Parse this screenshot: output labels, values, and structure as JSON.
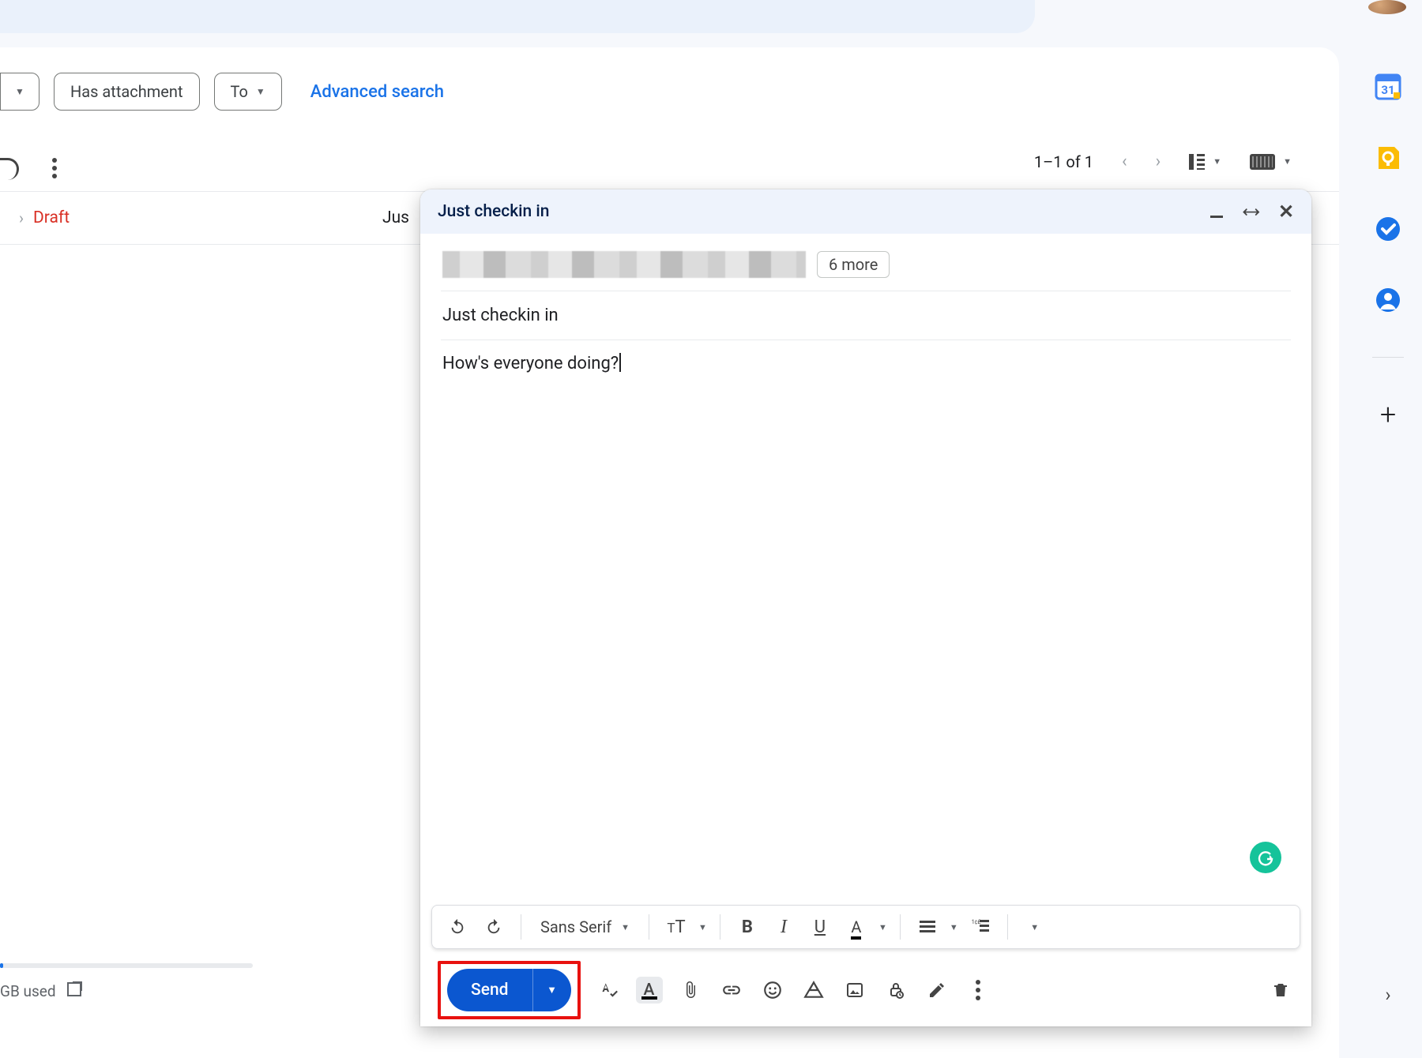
{
  "filters": {
    "has_attachment": "Has attachment",
    "to": "To",
    "advanced": "Advanced search"
  },
  "pager": {
    "count": "1–1 of 1"
  },
  "thread": {
    "label": "Draft",
    "subject_preview": "Jus"
  },
  "compose": {
    "header_title": "Just checkin in",
    "recipients_more": "6 more",
    "subject": "Just checkin in",
    "body": "How's everyone doing?",
    "font_family": "Sans Serif",
    "send_label": "Send",
    "text_color_letter": "A"
  },
  "storage": {
    "used_text": "GB used"
  },
  "sidepanel": {
    "calendar_day": "31"
  }
}
